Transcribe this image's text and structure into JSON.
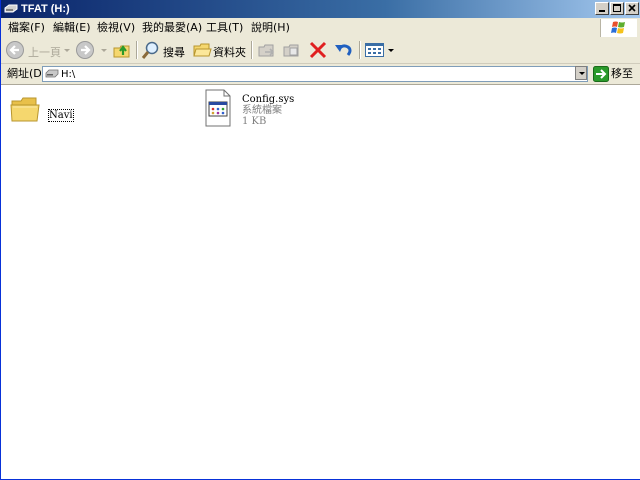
{
  "window": {
    "title": "TFAT (H:)",
    "title_icon": "drive-icon"
  },
  "menubar": {
    "items": [
      "檔案(F)",
      "編輯(E)",
      "檢視(V)",
      "我的最愛(A)",
      "工具(T)",
      "說明(H)"
    ]
  },
  "toolbar": {
    "back_label": "上一頁",
    "search_label": "搜尋",
    "folders_label": "資料夾"
  },
  "address": {
    "label": "網址(D)",
    "value": "H:\\",
    "go_label": "移至"
  },
  "files": [
    {
      "name": "Navi",
      "type": "folder"
    },
    {
      "name": "Config.sys",
      "kind": "系統檔案",
      "size": "1 KB",
      "type": "file"
    }
  ],
  "colors": {
    "titlebar": "#0a246a",
    "chrome": "#ece9d8",
    "folder": "#f5d76e",
    "delete_red": "#e02020",
    "undo_blue": "#2060c0",
    "go_green": "#2a9a2a"
  }
}
